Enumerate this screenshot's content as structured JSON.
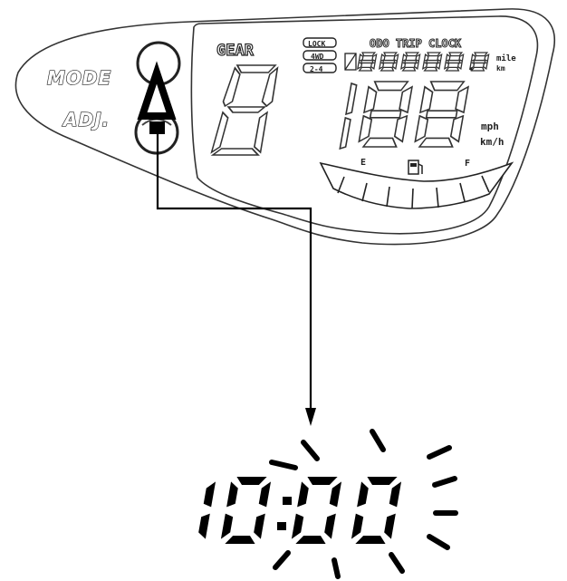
{
  "panel": {
    "mode_label": "MODE",
    "adj_label": "ADJ.",
    "gear_label": "GEAR",
    "indicators": [
      "LOCK",
      "4WD",
      "2-4"
    ],
    "top_labels": "ODO TRIP CLOCK",
    "odo_unit_top": "mile",
    "odo_unit_bottom": "km",
    "speed_unit_top": "mph",
    "speed_unit_bottom": "km/h",
    "fuel_empty": "E",
    "fuel_full": "F"
  },
  "clock": {
    "hours": "10",
    "minutes": "00",
    "state": "blinking"
  },
  "icons": [
    "up-arrow-icon",
    "fuel-pump-icon",
    "connector-arrow"
  ]
}
